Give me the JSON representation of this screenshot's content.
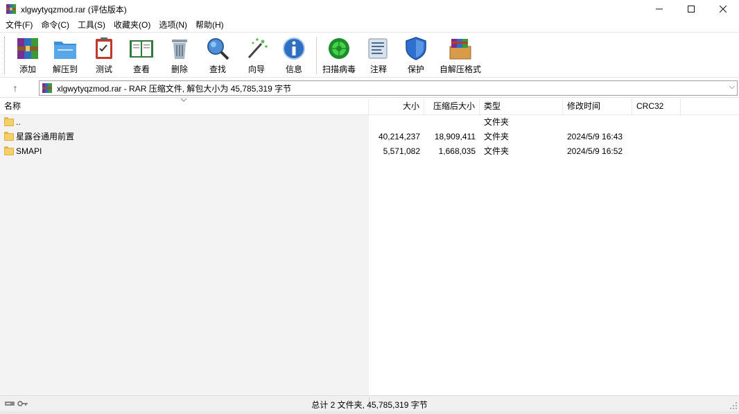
{
  "window": {
    "title": "xlgwytyqzmod.rar (评估版本)",
    "controls": {
      "minimize": "—",
      "maximize": "☐",
      "close": "✕"
    }
  },
  "menu": [
    "文件(F)",
    "命令(C)",
    "工具(S)",
    "收藏夹(O)",
    "选项(N)",
    "帮助(H)"
  ],
  "toolbar": {
    "add": "添加",
    "extract_to": "解压到",
    "test": "测试",
    "view": "查看",
    "delete": "删除",
    "find": "查找",
    "wizard": "向导",
    "info": "信息",
    "virus_scan": "扫描病毒",
    "comment": "注释",
    "protect": "保护",
    "sfx": "自解压格式"
  },
  "address": {
    "up_icon": "↑",
    "text": "xlgwytyqzmod.rar - RAR 压缩文件, 解包大小为 45,785,319 字节",
    "dropdown_icon": "⌵"
  },
  "columns": {
    "name": "名称",
    "size": "大小",
    "packed": "压缩后大小",
    "type": "类型",
    "modified": "修改时间",
    "crc": "CRC32"
  },
  "files": [
    {
      "name": "..",
      "size": "",
      "packed": "",
      "type": "文件夹",
      "modified": ""
    },
    {
      "name": "星露谷通用前置",
      "size": "40,214,237",
      "packed": "18,909,411",
      "type": "文件夹",
      "modified": "2024/5/9 16:43"
    },
    {
      "name": "SMAPI",
      "size": "5,571,082",
      "packed": "1,668,035",
      "type": "文件夹",
      "modified": "2024/5/9 16:52"
    }
  ],
  "status": {
    "summary": "总计 2 文件夹, 45,785,319 字节"
  },
  "colors": {
    "folder": "#f5cf67",
    "toolbar_separator": "#d0d0d0",
    "left_pane": "#f3f3f3",
    "status_bg": "#f0f0f0"
  }
}
